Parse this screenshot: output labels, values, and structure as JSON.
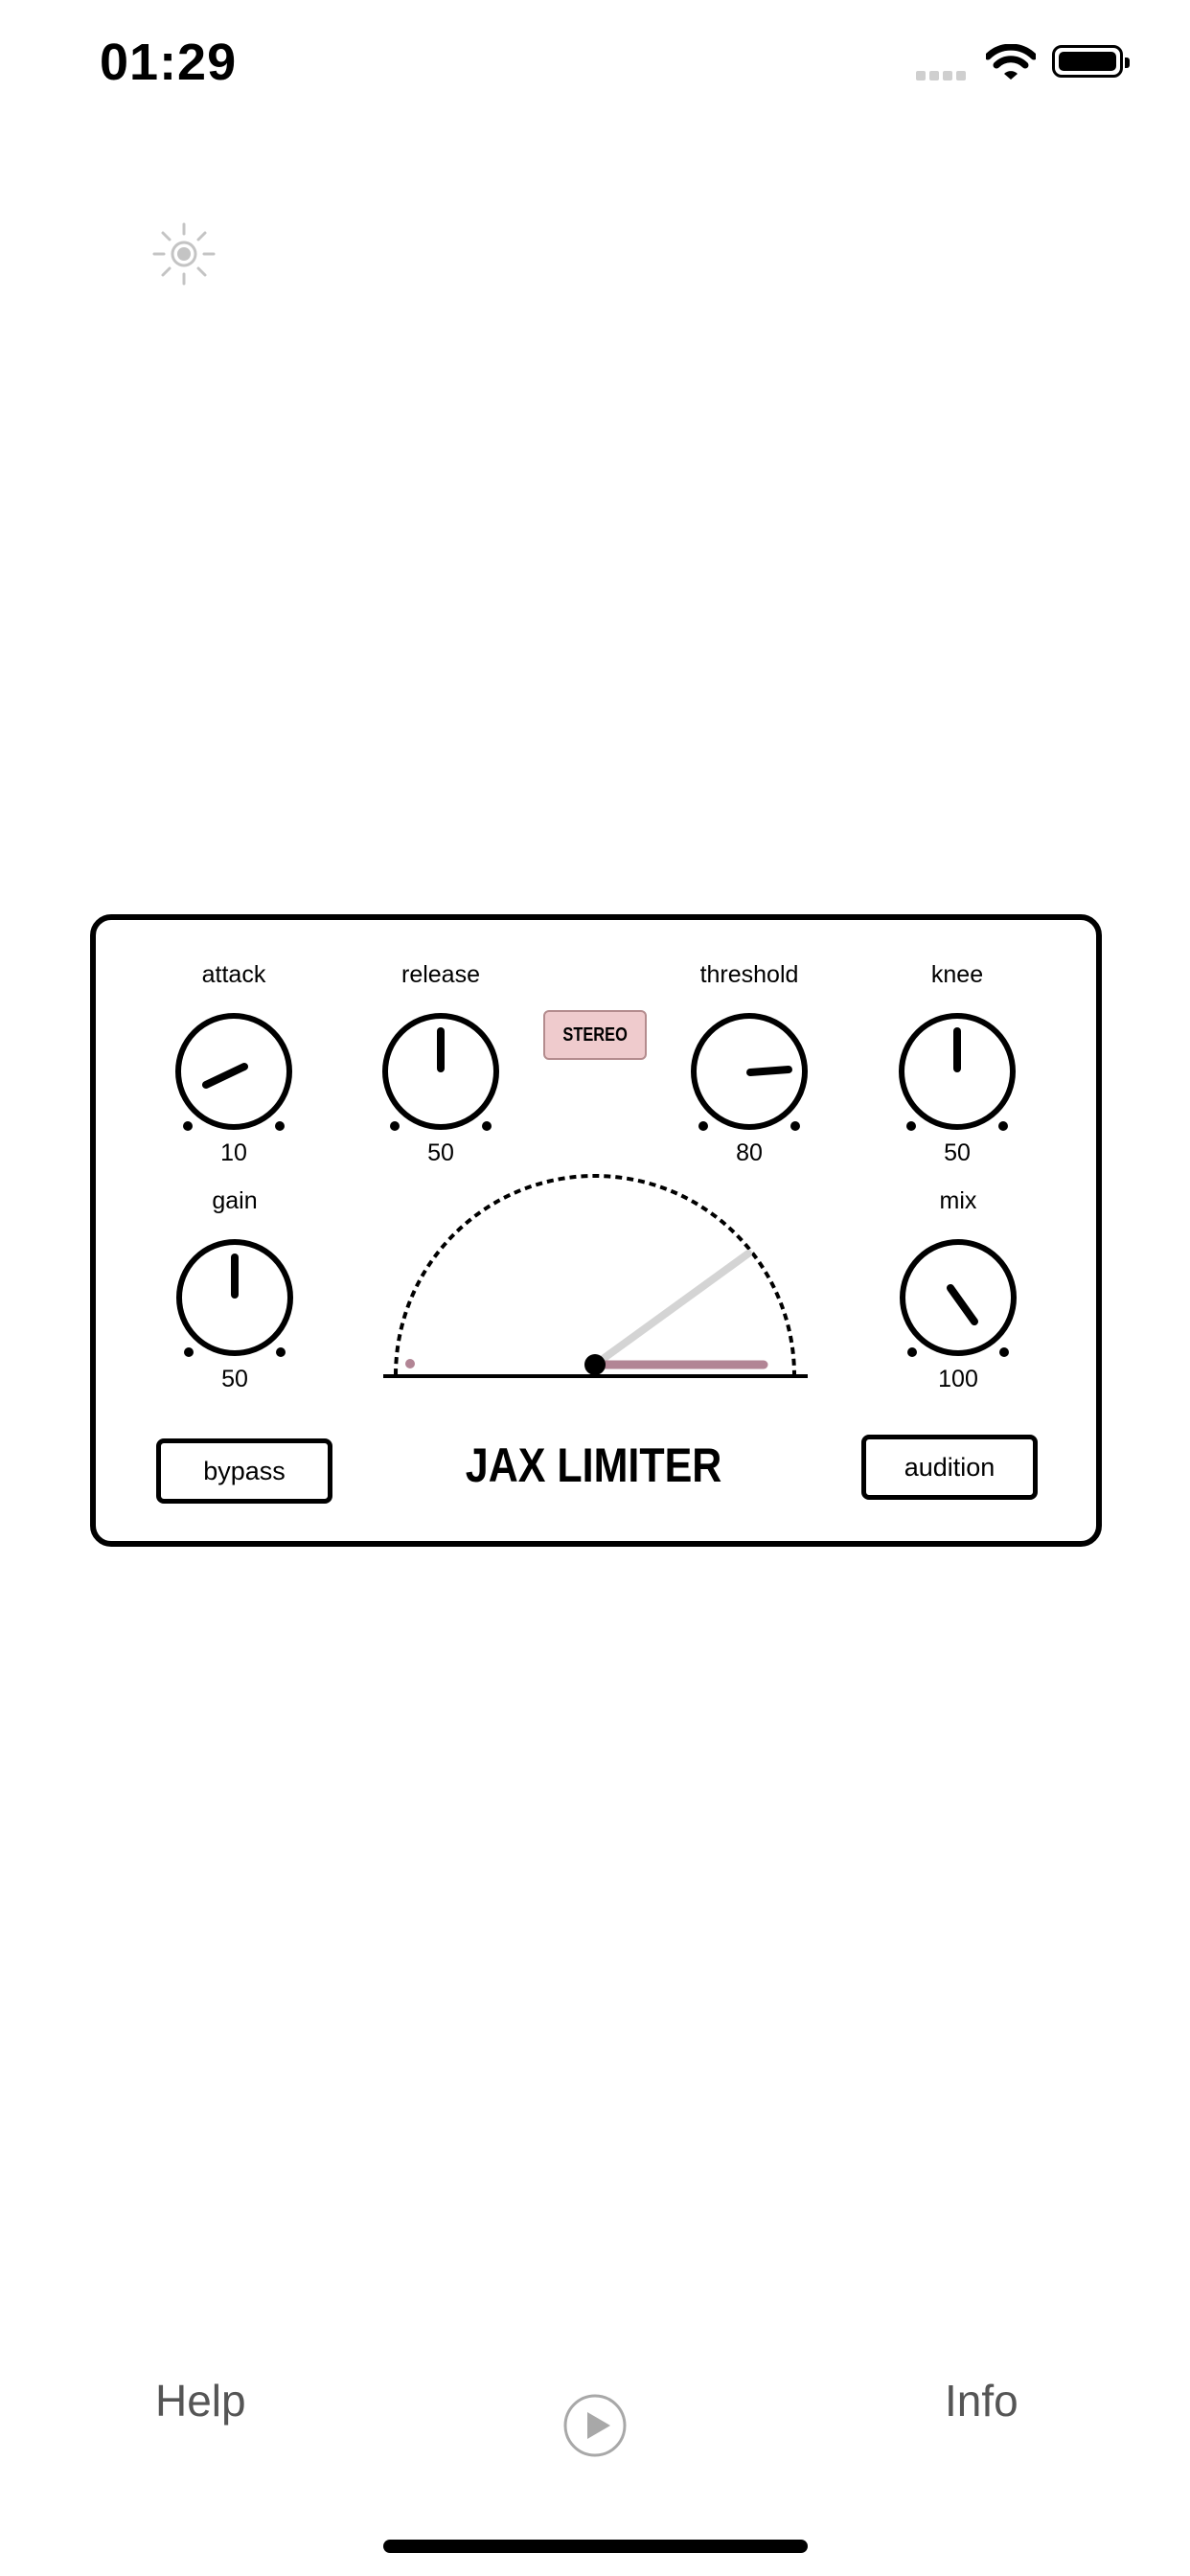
{
  "status_bar": {
    "time": "01:29",
    "signal_icon": "signal-dots-icon",
    "wifi_icon": "wifi-icon",
    "battery_icon": "battery-full-icon"
  },
  "brightness_icon": "sun-icon",
  "plugin": {
    "title": "JAX LIMITER",
    "stereo_label": "STEREO",
    "knobs": {
      "attack": {
        "label": "attack",
        "value": "10"
      },
      "release": {
        "label": "release",
        "value": "50"
      },
      "threshold": {
        "label": "threshold",
        "value": "80"
      },
      "knee": {
        "label": "knee",
        "value": "50"
      },
      "gain": {
        "label": "gain",
        "value": "50"
      },
      "mix": {
        "label": "mix",
        "value": "100"
      }
    },
    "bypass_label": "bypass",
    "audition_label": "audition",
    "colors": {
      "accent": "#b28595",
      "badge": "#efcbcd",
      "needle": "#d4d4d4"
    }
  },
  "bottom_bar": {
    "help_label": "Help",
    "info_label": "Info",
    "play_icon": "play-icon"
  }
}
